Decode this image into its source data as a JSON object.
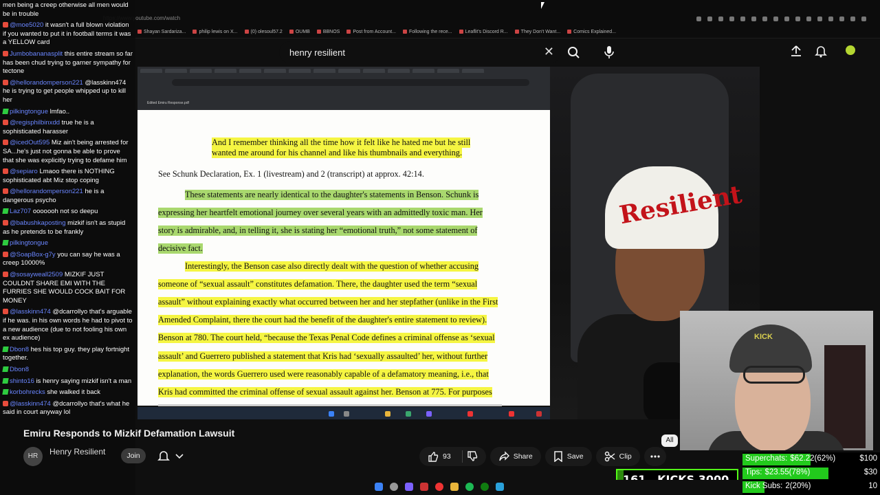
{
  "browser": {
    "url_fragment": "https://www.youtube.com/watch",
    "bookmarks": [
      "Shayan Sardariza...",
      "philip lewis on X...",
      "(0) olesoul57.2",
      "OUMB",
      "BBNOS",
      "Post from Account...",
      "Following the rece...",
      "Leaflit's Discord R...",
      "They Don't Want...",
      "Comics Explained..."
    ]
  },
  "header": {
    "search_query": "henry resilient"
  },
  "chat": [
    {
      "badge": "none",
      "user": "",
      "text": "men being a creep otherwise all men would be in trouble"
    },
    {
      "badge": "r",
      "user": "@moe5020",
      "text": "it wasn't a full blown violation if you wanted to put it in football terms it was a YELLOW card"
    },
    {
      "badge": "r",
      "user": "Jumbobananasplit",
      "text": "this entire stream so far has been chud trying to garner sympathy for tectone"
    },
    {
      "badge": "r",
      "user": "@hellorandomperson221",
      "text": "@lasskinn474 he is trying to get people whipped up to kill her"
    },
    {
      "badge": "g",
      "user": "pilkingtongue",
      "text": "lmfao.."
    },
    {
      "badge": "r",
      "user": "@regisphilbinxdd",
      "text": "true he is a sophisticated harasser"
    },
    {
      "badge": "r",
      "user": "@icedOut595",
      "text": "Miz ain't being arrested for SA...he's just not gonna be able to prove that she was explicitly trying to defame him"
    },
    {
      "badge": "r",
      "user": "@sepiaro",
      "text": "Lmaoo there is NOTHING sophisticated abt Miz stop coping"
    },
    {
      "badge": "r",
      "user": "@hellorandomperson221",
      "text": "he is a dangerous psycho"
    },
    {
      "badge": "g",
      "user": "Laz707",
      "text": "ooooooh not so deepu"
    },
    {
      "badge": "r",
      "user": "@babushkaposting",
      "text": "mizkif isn't as stupid as he pretends to be frankly"
    },
    {
      "badge": "g",
      "user": "pilkingtongue",
      "text": ""
    },
    {
      "badge": "r",
      "user": "@SoapBox-g7y",
      "text": "you can say he was a creep 10000%"
    },
    {
      "badge": "r",
      "user": "@sosayweall2509",
      "text": "MIZKIF JUST COULDNT SHARE EMI WITH THE FURRIES SHE WOULD COCK BAIT FOR MONEY"
    },
    {
      "badge": "r",
      "user": "@lasskinn474",
      "text": "@dcarrollyo that's arguable if he was. in his own words he had to pivot to a new audience (due to not fooling his own ex audience)"
    },
    {
      "badge": "g",
      "user": "Dbon8",
      "text": "hes his top guy. they play fortnight together."
    },
    {
      "badge": "g",
      "user": "Dbon8",
      "text": ""
    },
    {
      "badge": "g",
      "user": "shinto16",
      "text": "is henry saying mizkif isn't a man"
    },
    {
      "badge": "g",
      "user": "korbohrecks",
      "text": "she walked it back"
    },
    {
      "badge": "r",
      "user": "@lasskinn474",
      "text": "@dcarrollyo that's what he said in court anyway lol"
    }
  ],
  "document": {
    "title": "Edited Emiru Response.pdf",
    "lines": [
      {
        "text": "And I remember thinking all the time how it felt like he hated me but he still",
        "hl": "y"
      },
      {
        "text": "wanted me around for his channel and like his thumbnails and everything.",
        "hl": "y"
      },
      {
        "text": "See Schunk Declaration, Ex. 1 (livestream) and 2 (transcript) at approx. 42:14.",
        "hl": "none"
      },
      {
        "text": "These statements are nearly identical to the daughter's statements in Benson.  Schunk is",
        "hl": "g"
      },
      {
        "text": "expressing her heartfelt emotional journey over several years with an admittedly toxic man.  Her",
        "hl": "g"
      },
      {
        "text": "story is admirable, and, in telling it, she is stating her “emotional truth,” not some statement of",
        "hl": "g"
      },
      {
        "text": "decisive fact.",
        "hl": "g"
      },
      {
        "text": "Interestingly, the Benson case also directly dealt with the question of whether accusing",
        "hl": "y"
      },
      {
        "text": "someone of “sexual assault” constitutes defamation.  There, the daughter used the term “sexual",
        "hl": "y"
      },
      {
        "text": "assault” without explaining exactly what occurred between her and her stepfather (unlike in the First",
        "hl": "y"
      },
      {
        "text": "Amended Complaint, there the court had the benefit of the daughter's entire statement to review).",
        "hl": "y"
      },
      {
        "text": "Benson at 780.  The court held, “because the Texas Penal Code defines a criminal offense as ‘sexual",
        "hl": "y"
      },
      {
        "text": "assault’ and Guerrero published a statement that Kris had ‘sexually assaulted’ her, without further",
        "hl": "y"
      },
      {
        "text": "explanation, the words Guerrero used were reasonably capable of a defamatory meaning, i.e., that",
        "hl": "y"
      },
      {
        "text": "Kris had committed the criminal offense of sexual assault against her.  Benson at 775.  For purposes",
        "hl": "y"
      }
    ]
  },
  "webcam": {
    "cap_text": "Resilient",
    "small_cap_text": "KICK"
  },
  "video": {
    "title": "Emiru Responds to Mizkif Defamation Lawsuit",
    "channel": "Henry Resilient",
    "channel_initials": "HR",
    "join_label": "Join",
    "likes": "93",
    "share_label": "Share",
    "save_label": "Save",
    "clip_label": "Clip",
    "filter_chip": "All"
  },
  "kick": {
    "count": "161",
    "label": "KICKS",
    "goal": "3000",
    "progress": 0.054
  },
  "goals": [
    {
      "label": "Superchats:",
      "value": "$62.22(62%)",
      "target": "$100",
      "fraction": 0.62
    },
    {
      "label": "Tips:",
      "value": "$23.55(78%)",
      "target": "$30",
      "fraction": 0.78
    },
    {
      "label": "Kick Subs:",
      "value": "2(20%)",
      "target": "10",
      "fraction": 0.2
    }
  ],
  "colors": {
    "kick_green": "#53fc18",
    "goal_green": "#22ca1c",
    "highlight_yellow": "#f5f542",
    "highlight_green": "#a9d86e",
    "cap_red": "#c3131a"
  }
}
